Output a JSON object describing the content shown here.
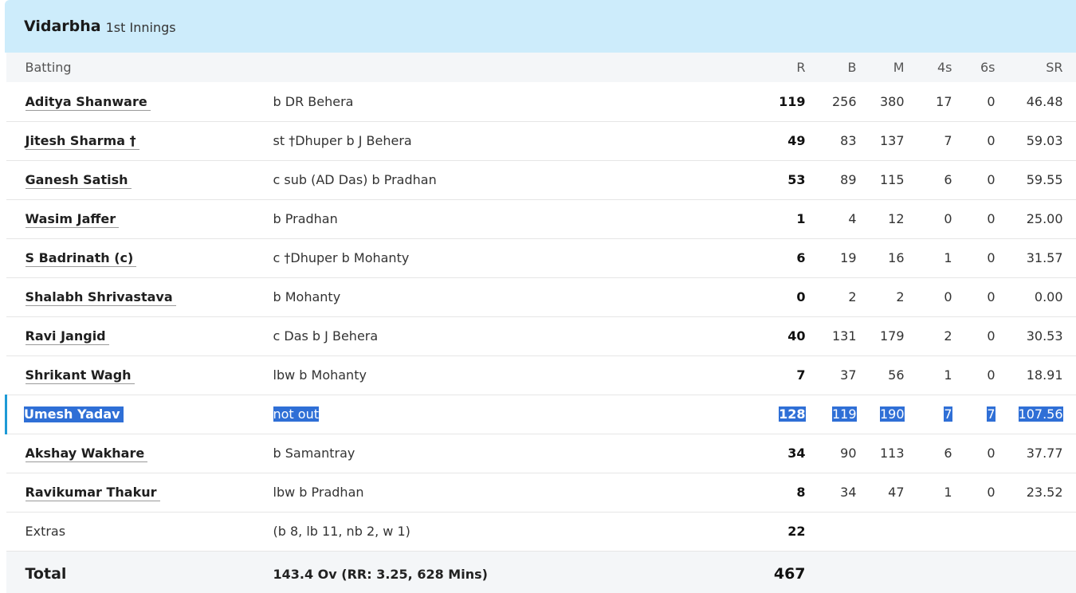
{
  "header": {
    "team": "Vidarbha",
    "innings": "1st Innings"
  },
  "columns": {
    "batting": "Batting",
    "r": "R",
    "b": "B",
    "m": "M",
    "fours": "4s",
    "sixes": "6s",
    "sr": "SR"
  },
  "batters": [
    {
      "name": "Aditya Shanware",
      "dismissal": "b DR Behera",
      "r": "119",
      "b": "256",
      "m": "380",
      "fours": "17",
      "sixes": "0",
      "sr": "46.48"
    },
    {
      "name": "Jitesh Sharma †",
      "dismissal": "st †Dhuper b J Behera",
      "r": "49",
      "b": "83",
      "m": "137",
      "fours": "7",
      "sixes": "0",
      "sr": "59.03"
    },
    {
      "name": "Ganesh Satish",
      "dismissal": "c sub (AD Das) b Pradhan",
      "r": "53",
      "b": "89",
      "m": "115",
      "fours": "6",
      "sixes": "0",
      "sr": "59.55"
    },
    {
      "name": "Wasim Jaffer",
      "dismissal": "b Pradhan",
      "r": "1",
      "b": "4",
      "m": "12",
      "fours": "0",
      "sixes": "0",
      "sr": "25.00"
    },
    {
      "name": "S Badrinath (c)",
      "dismissal": "c †Dhuper b Mohanty",
      "r": "6",
      "b": "19",
      "m": "16",
      "fours": "1",
      "sixes": "0",
      "sr": "31.57"
    },
    {
      "name": "Shalabh Shrivastava",
      "dismissal": "b Mohanty",
      "r": "0",
      "b": "2",
      "m": "2",
      "fours": "0",
      "sixes": "0",
      "sr": "0.00"
    },
    {
      "name": "Ravi Jangid",
      "dismissal": "c Das b J Behera",
      "r": "40",
      "b": "131",
      "m": "179",
      "fours": "2",
      "sixes": "0",
      "sr": "30.53"
    },
    {
      "name": "Shrikant Wagh",
      "dismissal": "lbw b Mohanty",
      "r": "7",
      "b": "37",
      "m": "56",
      "fours": "1",
      "sixes": "0",
      "sr": "18.91"
    },
    {
      "name": "Umesh Yadav",
      "dismissal": "not out",
      "r": "128",
      "b": "119",
      "m": "190",
      "fours": "7",
      "sixes": "7",
      "sr": "107.56"
    },
    {
      "name": "Akshay Wakhare",
      "dismissal": "b Samantray",
      "r": "34",
      "b": "90",
      "m": "113",
      "fours": "6",
      "sixes": "0",
      "sr": "37.77"
    },
    {
      "name": "Ravikumar Thakur",
      "dismissal": "lbw b Pradhan",
      "r": "8",
      "b": "34",
      "m": "47",
      "fours": "1",
      "sixes": "0",
      "sr": "23.52"
    }
  ],
  "extras": {
    "label": "Extras",
    "detail": "(b 8, lb 11, nb 2, w 1)",
    "value": "22"
  },
  "total": {
    "label": "Total",
    "detail": "143.4 Ov (RR: 3.25, 628 Mins)",
    "value": "467"
  },
  "colors": {
    "header_bg": "#cdecfb",
    "selection_bg": "#2f6fd6",
    "selection_bar": "#1e9ad6"
  }
}
